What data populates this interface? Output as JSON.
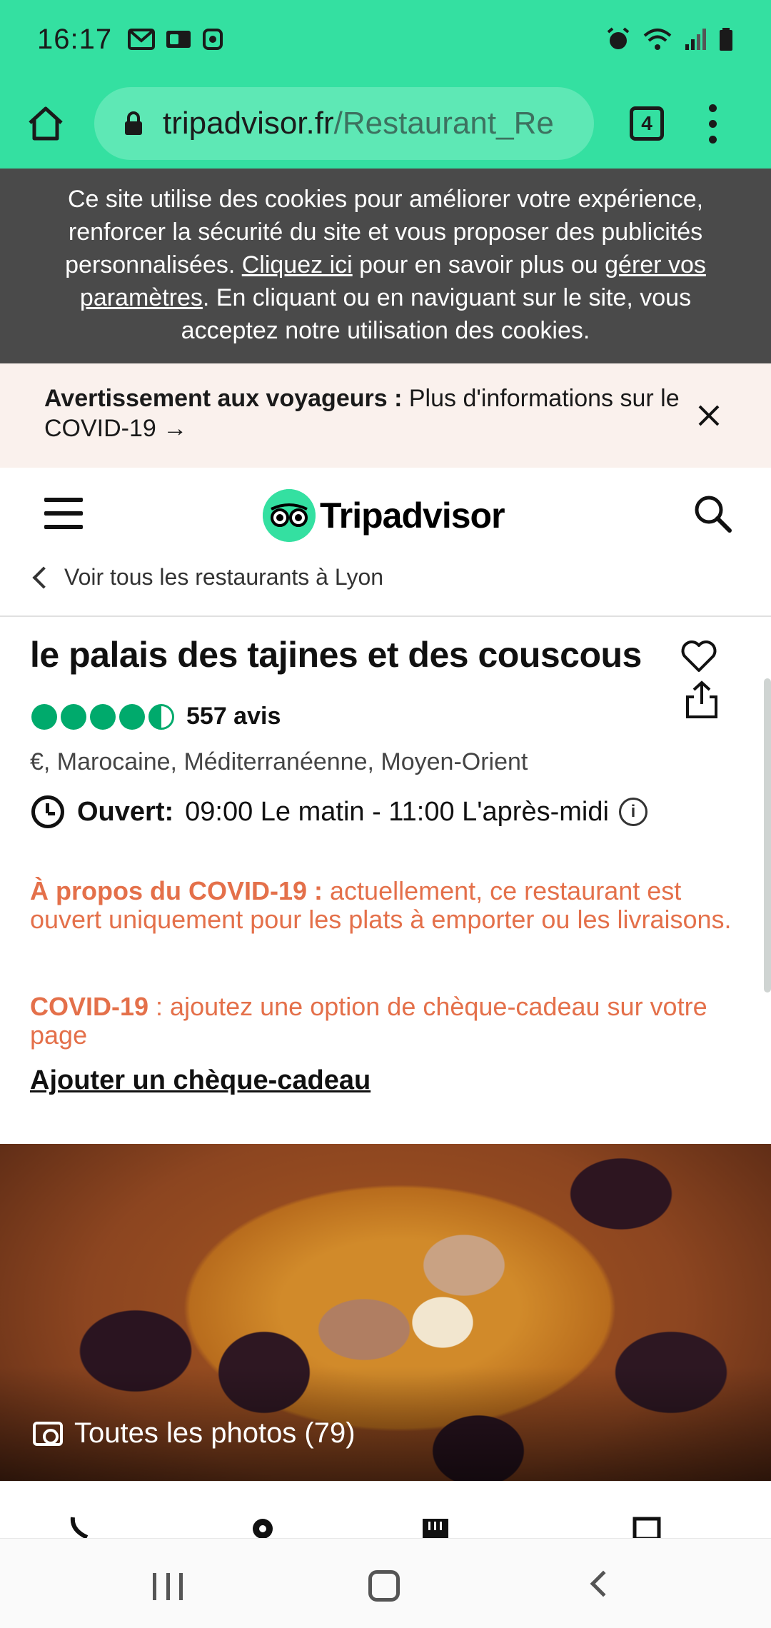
{
  "status_bar": {
    "time": "16:17"
  },
  "browser": {
    "url_domain": "tripadvisor.fr",
    "url_path": "/Restaurant_Re",
    "tab_count": "4"
  },
  "cookie_banner": {
    "text_1": "Ce site utilise des cookies pour améliorer votre expérience, renforcer la sécurité du site et vous proposer des publicités personnalisées. ",
    "link_1": "Cliquez ici",
    "text_2": " pour en savoir plus ou ",
    "link_2": "gérer vos paramètres",
    "text_3": ". En cliquant ou en naviguant sur le site, vous acceptez notre utilisation des cookies."
  },
  "covid_warning": {
    "label": "Avertissement aux voyageurs :",
    "text": " Plus d'informations sur le COVID-19 →"
  },
  "header": {
    "logo_text": "Tripadvisor"
  },
  "back_link": {
    "label": "Voir tous les restaurants à Lyon"
  },
  "restaurant": {
    "name": "le palais des tajines et des couscous",
    "rating": 4.5,
    "review_count": "557 avis",
    "cuisine": "€, Marocaine, Méditerranéenne, Moyen-Orient",
    "hours_label": "Ouvert:",
    "hours_value": "09:00 Le matin - 11:00 L'après-midi"
  },
  "covid_notes": {
    "note1_label": "À propos du COVID-19 :",
    "note1_text": "  actuellement, ce restaurant est ouvert uniquement pour les plats à emporter ou les livraisons.",
    "note2_label": "COVID-19",
    "note2_text": " : ajoutez une option de chèque-cadeau sur votre page",
    "gift_link": "Ajouter un chèque-cadeau"
  },
  "photo": {
    "caption": "Toutes les photos (79)"
  },
  "icons": {
    "home": "home-icon",
    "lock": "lock-icon",
    "menu": "more-vert-icon",
    "close": "close-icon",
    "hamburger": "hamburger-icon",
    "search": "search-icon",
    "heart": "heart-icon",
    "share": "share-icon",
    "clock": "clock-icon",
    "info": "info-icon",
    "camera": "camera-icon"
  },
  "colors": {
    "brand_green": "#34e0a1",
    "rating_green": "#00aa6c",
    "covid_orange": "#e4704a",
    "cookie_bg": "#4a4a4a"
  }
}
